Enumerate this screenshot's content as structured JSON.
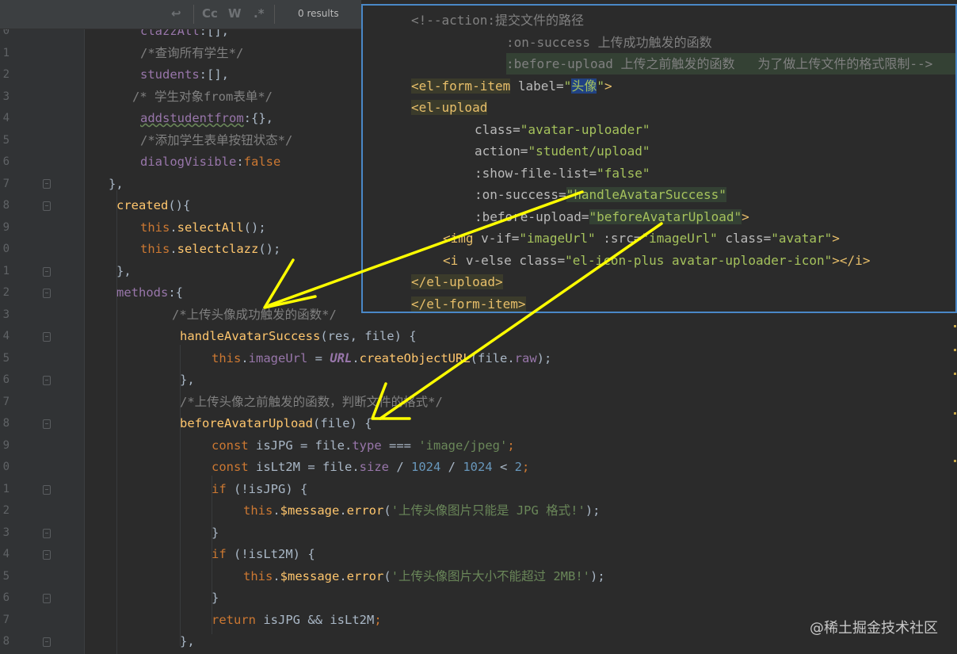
{
  "find_bar": {
    "results": "0 results",
    "icons": [
      "wrap-icon",
      "match-case-icon",
      "whole-word-icon",
      "regex-icon"
    ],
    "match_case": "Cc",
    "whole_word": "W",
    "regex": ".*"
  },
  "gutter": {
    "line_numbers": [
      "0",
      "1",
      "2",
      "3",
      "4",
      "5",
      "6",
      "7",
      "8",
      "9",
      "0",
      "1",
      "2",
      "3",
      "4",
      "5",
      "6",
      "7",
      "8",
      "9",
      "0",
      "1",
      "2",
      "3",
      "4",
      "5",
      "6",
      "7",
      "8"
    ]
  },
  "editor": {
    "l01_prop": "clazzAll",
    "l01_rest": ":[],",
    "l02": "/*查询所有学生*/",
    "l03_prop": "students",
    "l03_rest": ":[],",
    "l04": "/* 学生对象from表单*/",
    "l05_prop": "addstudentfrom",
    "l05_rest": ":{},",
    "l06": "/*添加学生表单按钮状态*/",
    "l07_prop": "dialogVisible",
    "l07_colon": ":",
    "l07_val": "false",
    "l08": "},",
    "l09_fn": "created",
    "l09_rest": "(){",
    "l10_this": "this",
    "l10_dot": ".",
    "l10_fn": "selectAll",
    "l10_rest": "();",
    "l11_this": "this",
    "l11_dot": ".",
    "l11_fn": "selectclazz",
    "l11_rest": "();",
    "l12": "},",
    "l13_key": "methods",
    "l13_rest": ":{",
    "l14": "/*上传头像成功触发的函数*/",
    "l15_fn": "handleAvatarSuccess",
    "l15_rest": "(res, file) {",
    "l16_this": "this",
    "l16_dot": ".",
    "l16_prop": "imageUrl",
    "l16_eq": " = ",
    "l16_url": "URL",
    "l16_dot2": ".",
    "l16_fn": "createObjectURL",
    "l16_open": "(file.",
    "l16_raw": "raw",
    "l16_close": ");",
    "l17": "},",
    "l18": "/*上传头像之前触发的函数，判断文件的格式*/",
    "l19_fn": "beforeAvatarUpload",
    "l19_rest": "(file) {",
    "l20_const": "const",
    "l20_mid": " isJPG = file.",
    "l20_type": "type",
    "l20_op": " === ",
    "l20_str": "'image/jpeg'",
    "l20_end": ";",
    "l21_const": "const",
    "l21_mid": " isLt2M = file.",
    "l21_size": "size",
    "l21_div": " / ",
    "l21_n1": "1024",
    "l21_div2": " / ",
    "l21_n2": "1024",
    "l21_lt": " < ",
    "l21_n3": "2",
    "l21_end": ";",
    "l22_if": "if",
    "l22_rest": " (!isJPG) {",
    "l23_this": "this",
    "l23_dot": ".",
    "l23_prop": "$message",
    "l23_dot2": ".",
    "l23_fn": "error",
    "l23_open": "(",
    "l23_str": "'上传头像图片只能是 JPG 格式!'",
    "l23_close": ");",
    "l24": "}",
    "l25_if": "if",
    "l25_rest": " (!isLt2M) {",
    "l26_this": "this",
    "l26_dot": ".",
    "l26_prop": "$message",
    "l26_dot2": ".",
    "l26_fn": "error",
    "l26_open": "(",
    "l26_str": "'上传头像图片大小不能超过 2MB!'",
    "l26_close": ");",
    "l27": "}",
    "l28_ret": "return",
    "l28_rest": " isJPG && isLt2M",
    "l28_end": ";",
    "l29": "},"
  },
  "popup": {
    "p01": "<!--action:提交文件的路径",
    "p02": ":on-success 上传成功触发的函数",
    "p03": ":before-upload 上传之前触发的函数   为了做上传文件的格式限制-->",
    "p04_open": "<el-form-item",
    "p04_attr": " label=",
    "p04_q1": "\"",
    "p04_val": "头像",
    "p04_q2": "\"",
    "p04_close": ">",
    "p05": "<el-upload",
    "p06_attr": "class=",
    "p06_val": "\"avatar-uploader\"",
    "p07_attr": "action=",
    "p07_val": "\"student/upload\"",
    "p08_attr": ":show-file-list=",
    "p08_val": "\"false\"",
    "p09_attr": ":on-success=",
    "p09_val": "\"handleAvatarSuccess\"",
    "p10_attr": ":before-upload=",
    "p10_val": "\"beforeAvatarUpload\"",
    "p10_close": ">",
    "p11_open": "<img",
    "p11_a1": " v-if=",
    "p11_v1": "\"imageUrl\"",
    "p11_a2": " :src=",
    "p11_v2": "\"imageUrl\"",
    "p11_a3": " class=",
    "p11_v3": "\"avatar\"",
    "p11_close": ">",
    "p12_open": "<i",
    "p12_a1": " v-else class=",
    "p12_v1": "\"el-icon-plus avatar-uploader-icon\"",
    "p12_close": "></i>",
    "p13": "</el-upload>",
    "p14": "</el-form-item>"
  },
  "watermark": "@稀土掘金技术社区",
  "colors": {
    "background": "#2b2b2b",
    "keyword": "#cc7832",
    "property": "#9876aa",
    "function": "#ffc66d",
    "comment": "#808080",
    "string": "#6a8759",
    "number": "#6897bb",
    "tag": "#e8bf6a",
    "popup_border": "#4a88c7",
    "annotation": "#ffff00"
  }
}
